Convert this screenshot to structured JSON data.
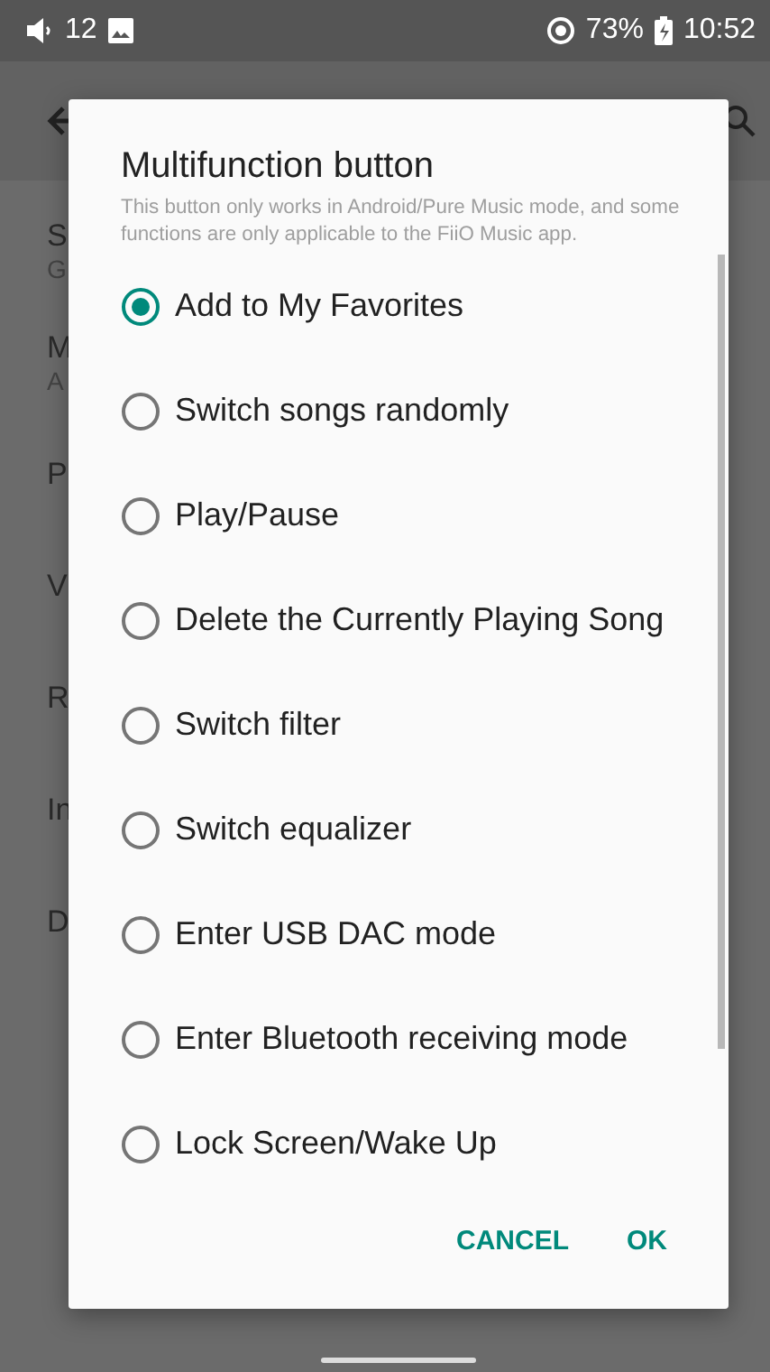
{
  "status_bar": {
    "volume": "12",
    "battery": "73%",
    "time": "10:52"
  },
  "background_list": [
    {
      "title": "S",
      "subtitle": "G"
    },
    {
      "title": "M",
      "subtitle": "A"
    },
    {
      "title": "P"
    },
    {
      "title": "V"
    },
    {
      "title": "R"
    },
    {
      "title": "In"
    },
    {
      "title": "D"
    }
  ],
  "dialog": {
    "title": "Multifunction button",
    "description": "This button only works in Android/Pure Music mode, and some functions are only applicable to the FiiO Music app.",
    "options": [
      {
        "label": "Add to My Favorites",
        "selected": true
      },
      {
        "label": "Switch songs randomly",
        "selected": false
      },
      {
        "label": "Play/Pause",
        "selected": false
      },
      {
        "label": "Delete the Currently Playing Song",
        "selected": false
      },
      {
        "label": "Switch filter",
        "selected": false
      },
      {
        "label": "Switch equalizer",
        "selected": false
      },
      {
        "label": "Enter USB DAC mode",
        "selected": false
      },
      {
        "label": "Enter Bluetooth receiving mode",
        "selected": false
      },
      {
        "label": "Lock Screen/Wake Up",
        "selected": false
      }
    ],
    "buttons": [
      "CANCEL",
      "OK"
    ]
  }
}
